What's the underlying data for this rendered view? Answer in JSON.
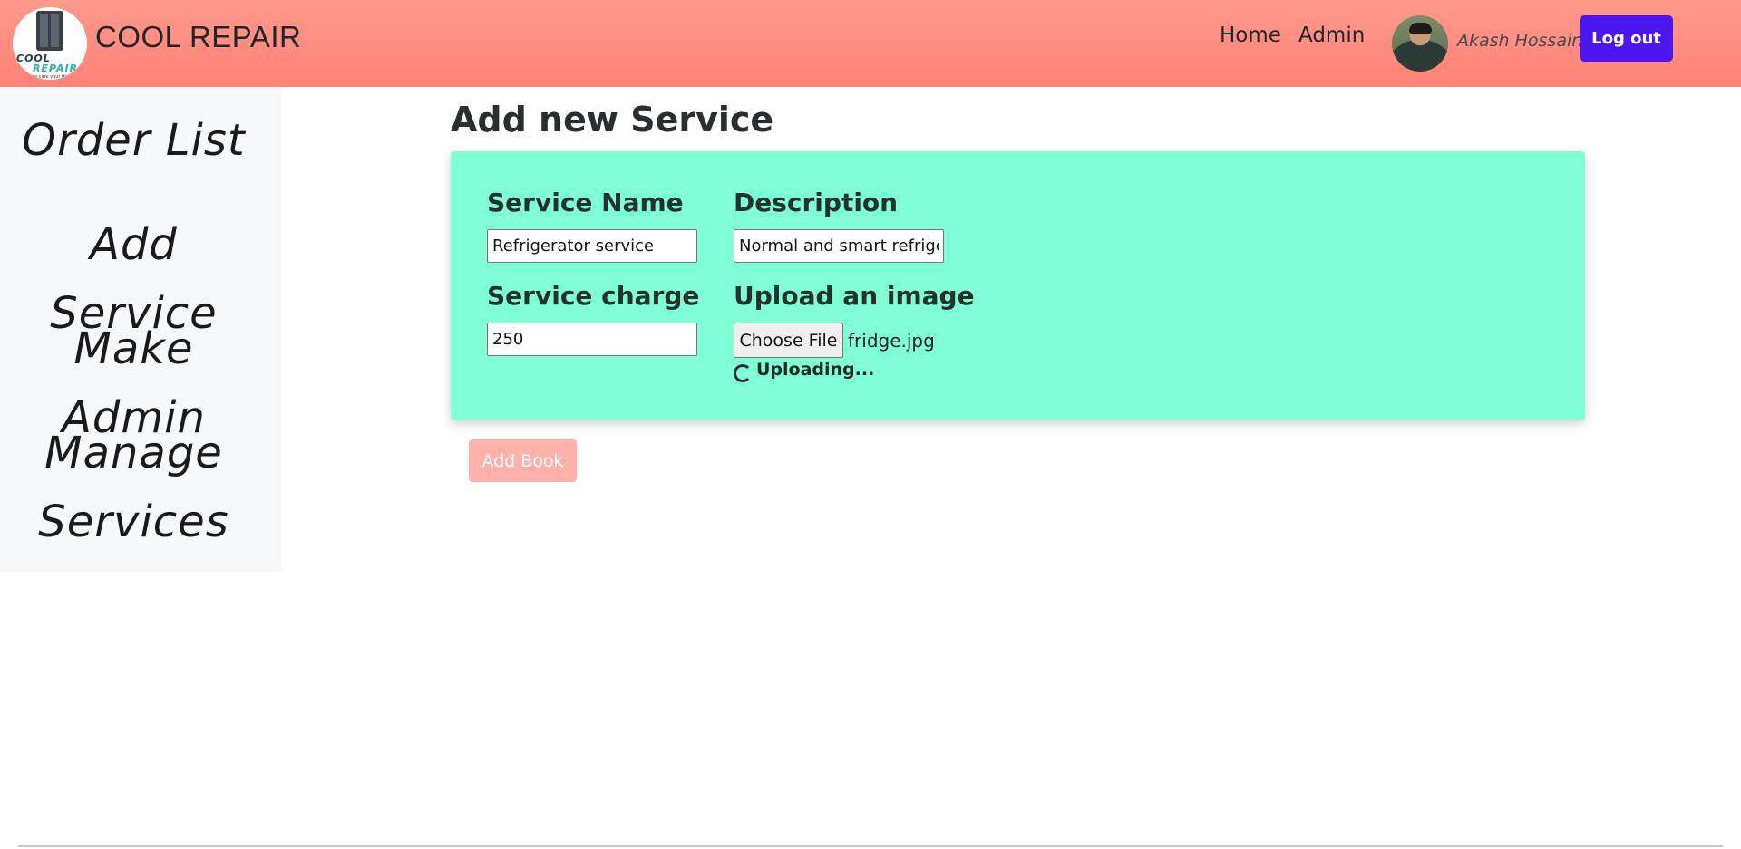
{
  "header": {
    "brand": "COOL REPAIR",
    "logo": {
      "line1": "COOL",
      "line2": "REPAIR",
      "tagline": "we care your fridge"
    },
    "nav": [
      {
        "label": "Home"
      },
      {
        "label": "Admin"
      }
    ],
    "user": {
      "name": "Akash Hossain"
    },
    "logout_label": "Log out",
    "colors": {
      "gradient_top": "#ff9a8b",
      "gradient_bottom": "#ff8177",
      "logout_bg": "#4b16f0"
    }
  },
  "sidebar": {
    "items": [
      {
        "label": "Order List"
      },
      {
        "label": "Add Service"
      },
      {
        "label": "Make Admin"
      },
      {
        "label": "Manage Services"
      }
    ]
  },
  "main": {
    "title": "Add new Service",
    "form": {
      "card_color": "#80ffd6",
      "service_name": {
        "label": "Service Name",
        "value": "Refrigerator service"
      },
      "description": {
        "label": "Description",
        "value": "Normal and smart refrigerator service"
      },
      "service_charge": {
        "label": "Service charge",
        "value": "250"
      },
      "upload": {
        "label": "Upload an image",
        "button_label": "Choose File",
        "file_name": "fridge.jpg",
        "status": "Uploading..."
      }
    },
    "submit_label": "Add Book",
    "submit_color": "#ffb0a8"
  }
}
